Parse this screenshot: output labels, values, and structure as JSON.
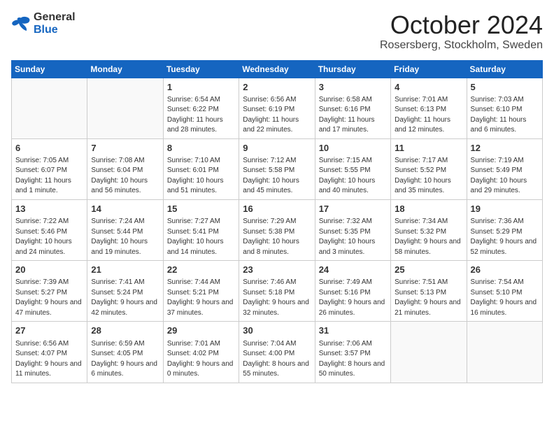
{
  "header": {
    "logo_general": "General",
    "logo_blue": "Blue",
    "month_title": "October 2024",
    "location": "Rosersberg, Stockholm, Sweden"
  },
  "days_of_week": [
    "Sunday",
    "Monday",
    "Tuesday",
    "Wednesday",
    "Thursday",
    "Friday",
    "Saturday"
  ],
  "weeks": [
    [
      {
        "day": "",
        "info": ""
      },
      {
        "day": "",
        "info": ""
      },
      {
        "day": "1",
        "info": "Sunrise: 6:54 AM\nSunset: 6:22 PM\nDaylight: 11 hours and 28 minutes."
      },
      {
        "day": "2",
        "info": "Sunrise: 6:56 AM\nSunset: 6:19 PM\nDaylight: 11 hours and 22 minutes."
      },
      {
        "day": "3",
        "info": "Sunrise: 6:58 AM\nSunset: 6:16 PM\nDaylight: 11 hours and 17 minutes."
      },
      {
        "day": "4",
        "info": "Sunrise: 7:01 AM\nSunset: 6:13 PM\nDaylight: 11 hours and 12 minutes."
      },
      {
        "day": "5",
        "info": "Sunrise: 7:03 AM\nSunset: 6:10 PM\nDaylight: 11 hours and 6 minutes."
      }
    ],
    [
      {
        "day": "6",
        "info": "Sunrise: 7:05 AM\nSunset: 6:07 PM\nDaylight: 11 hours and 1 minute."
      },
      {
        "day": "7",
        "info": "Sunrise: 7:08 AM\nSunset: 6:04 PM\nDaylight: 10 hours and 56 minutes."
      },
      {
        "day": "8",
        "info": "Sunrise: 7:10 AM\nSunset: 6:01 PM\nDaylight: 10 hours and 51 minutes."
      },
      {
        "day": "9",
        "info": "Sunrise: 7:12 AM\nSunset: 5:58 PM\nDaylight: 10 hours and 45 minutes."
      },
      {
        "day": "10",
        "info": "Sunrise: 7:15 AM\nSunset: 5:55 PM\nDaylight: 10 hours and 40 minutes."
      },
      {
        "day": "11",
        "info": "Sunrise: 7:17 AM\nSunset: 5:52 PM\nDaylight: 10 hours and 35 minutes."
      },
      {
        "day": "12",
        "info": "Sunrise: 7:19 AM\nSunset: 5:49 PM\nDaylight: 10 hours and 29 minutes."
      }
    ],
    [
      {
        "day": "13",
        "info": "Sunrise: 7:22 AM\nSunset: 5:46 PM\nDaylight: 10 hours and 24 minutes."
      },
      {
        "day": "14",
        "info": "Sunrise: 7:24 AM\nSunset: 5:44 PM\nDaylight: 10 hours and 19 minutes."
      },
      {
        "day": "15",
        "info": "Sunrise: 7:27 AM\nSunset: 5:41 PM\nDaylight: 10 hours and 14 minutes."
      },
      {
        "day": "16",
        "info": "Sunrise: 7:29 AM\nSunset: 5:38 PM\nDaylight: 10 hours and 8 minutes."
      },
      {
        "day": "17",
        "info": "Sunrise: 7:32 AM\nSunset: 5:35 PM\nDaylight: 10 hours and 3 minutes."
      },
      {
        "day": "18",
        "info": "Sunrise: 7:34 AM\nSunset: 5:32 PM\nDaylight: 9 hours and 58 minutes."
      },
      {
        "day": "19",
        "info": "Sunrise: 7:36 AM\nSunset: 5:29 PM\nDaylight: 9 hours and 52 minutes."
      }
    ],
    [
      {
        "day": "20",
        "info": "Sunrise: 7:39 AM\nSunset: 5:27 PM\nDaylight: 9 hours and 47 minutes."
      },
      {
        "day": "21",
        "info": "Sunrise: 7:41 AM\nSunset: 5:24 PM\nDaylight: 9 hours and 42 minutes."
      },
      {
        "day": "22",
        "info": "Sunrise: 7:44 AM\nSunset: 5:21 PM\nDaylight: 9 hours and 37 minutes."
      },
      {
        "day": "23",
        "info": "Sunrise: 7:46 AM\nSunset: 5:18 PM\nDaylight: 9 hours and 32 minutes."
      },
      {
        "day": "24",
        "info": "Sunrise: 7:49 AM\nSunset: 5:16 PM\nDaylight: 9 hours and 26 minutes."
      },
      {
        "day": "25",
        "info": "Sunrise: 7:51 AM\nSunset: 5:13 PM\nDaylight: 9 hours and 21 minutes."
      },
      {
        "day": "26",
        "info": "Sunrise: 7:54 AM\nSunset: 5:10 PM\nDaylight: 9 hours and 16 minutes."
      }
    ],
    [
      {
        "day": "27",
        "info": "Sunrise: 6:56 AM\nSunset: 4:07 PM\nDaylight: 9 hours and 11 minutes."
      },
      {
        "day": "28",
        "info": "Sunrise: 6:59 AM\nSunset: 4:05 PM\nDaylight: 9 hours and 6 minutes."
      },
      {
        "day": "29",
        "info": "Sunrise: 7:01 AM\nSunset: 4:02 PM\nDaylight: 9 hours and 0 minutes."
      },
      {
        "day": "30",
        "info": "Sunrise: 7:04 AM\nSunset: 4:00 PM\nDaylight: 8 hours and 55 minutes."
      },
      {
        "day": "31",
        "info": "Sunrise: 7:06 AM\nSunset: 3:57 PM\nDaylight: 8 hours and 50 minutes."
      },
      {
        "day": "",
        "info": ""
      },
      {
        "day": "",
        "info": ""
      }
    ]
  ]
}
